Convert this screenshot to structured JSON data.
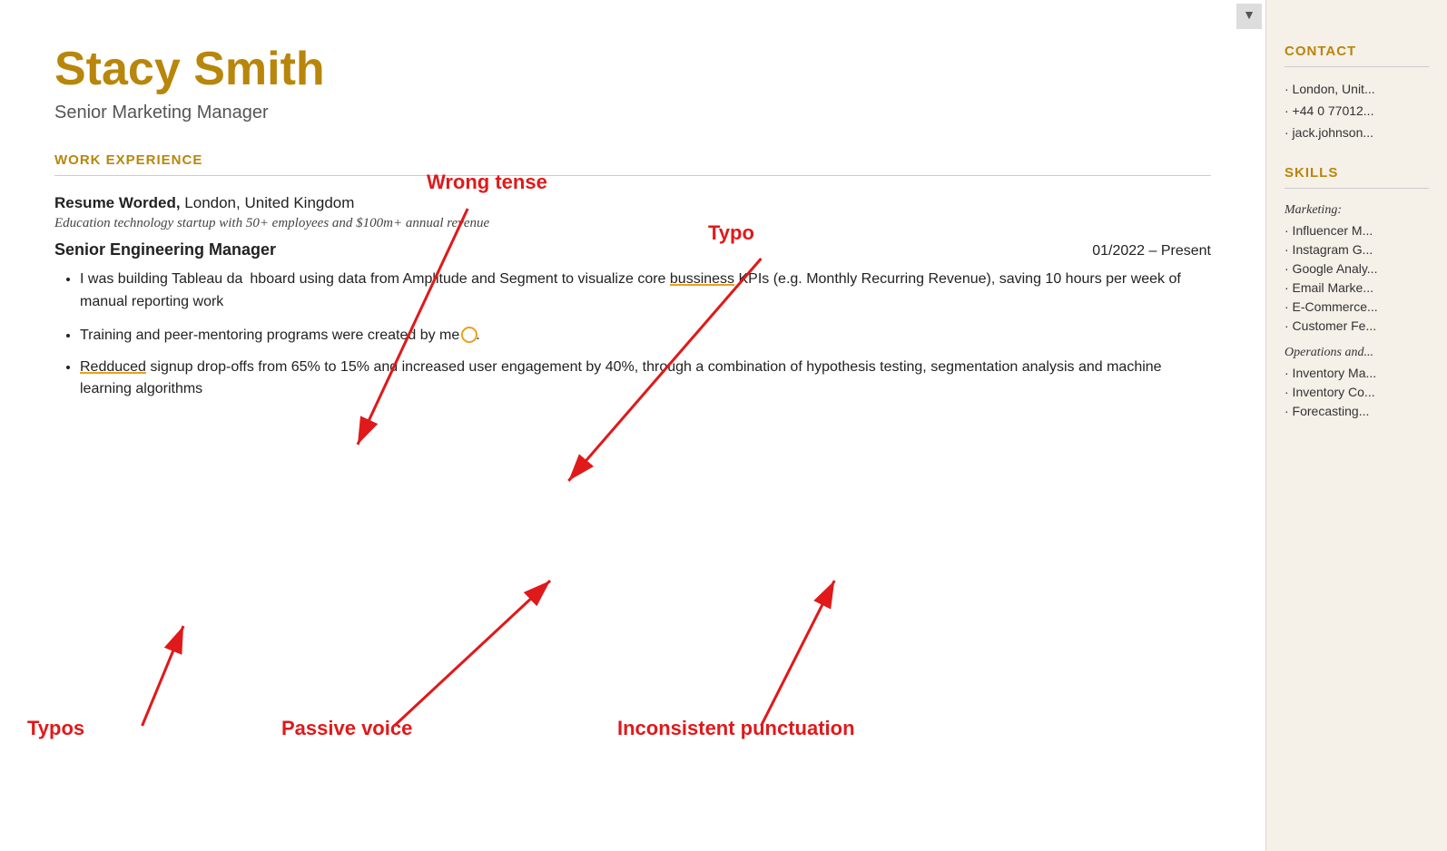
{
  "scroll_indicator": "▼",
  "candidate": {
    "name": "Stacy Smith",
    "title": "Senior Marketing Manager"
  },
  "sections": {
    "work_experience_heading": "WORK EXPERIENCE",
    "company": "Resume Worded,",
    "company_location": " London, United Kingdom",
    "company_desc": "Education technology startup with 50+ employees and $100m+ annual revenue",
    "job_title": "Senior Engineering Manager",
    "job_dates": "01/2022 – Present",
    "bullets": [
      "I was building Tableau dashboard using data from Amplitude and Segment to visualize core bussiness KPIs (e.g. Monthly Recurring Revenue), saving 10 hours per week of manual reporting work",
      "Training and peer-mentoring programs were created by me.",
      "Redduced signup drop-offs from 65% to 15% and increased user engagement by 40%, through a combination of hypothesis testing, segmentation analysis and machine learning algorithms"
    ]
  },
  "annotations": {
    "wrong_tense": "Wrong tense",
    "typo_top": "Typo",
    "typos_bottom": "Typos",
    "passive_voice": "Passive voice",
    "inconsistent_punctuation": "Inconsistent punctuation"
  },
  "sidebar": {
    "contact_heading": "CONTACT",
    "contact_items": [
      "· London, Unit...",
      "· +44 0 77012...",
      "· jack.johnson..."
    ],
    "skills_heading": "SKILLS",
    "skills_categories": [
      {
        "category": "Marketing:",
        "items": [
          "· Influencer M...",
          "· Instagram G...",
          "· Google Analy...",
          "· Email Marke...",
          "· E-Commerce...",
          "· Customer Fe..."
        ]
      },
      {
        "category": "Operations and...",
        "items": [
          "· Inventory Ma...",
          "· Inventory Co...",
          "· Forecasting..."
        ]
      }
    ]
  }
}
